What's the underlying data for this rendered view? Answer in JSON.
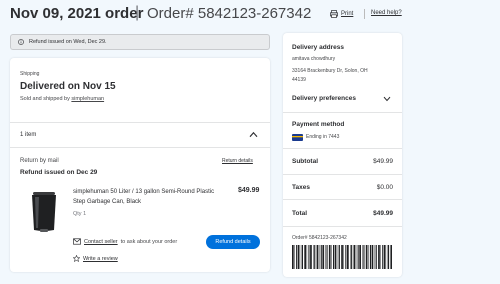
{
  "header": {
    "order_date": "Nov 09, 2021 order",
    "order_number": "Order# 5842123-267342",
    "print_label": "Print",
    "help_label": "Need help?"
  },
  "banner": {
    "text": "Refund issued on Wed, Dec 29."
  },
  "shipment": {
    "tag": "Shipping",
    "status": "Delivered on Nov 15",
    "sold_by_prefix": "Sold and shipped by",
    "seller": "simplehuman",
    "items_count": "1 item"
  },
  "return_info": {
    "method": "Return by mail",
    "details_link": "Return details",
    "refund_status": "Refund issued on Dec 29"
  },
  "product": {
    "title": "simplehuman 50 Liter / 13 gallon Semi-Round Plastic Step Garbage Can, Black",
    "price": "$49.99",
    "qty": "Qty 1",
    "contact_link": "Contact seller",
    "contact_suffix": "to ask about your order",
    "refund_button": "Refund details",
    "review_link": "Write a review"
  },
  "sidebar": {
    "delivery_address_label": "Delivery address",
    "address_line1": "amitava chowdhury",
    "address_line2": "33164 Brackenbury Dr, Solon, OH",
    "address_line3": "44139",
    "delivery_prefs_label": "Delivery preferences",
    "payment_label": "Payment method",
    "card_text": "Ending in 7443",
    "subtotal_label": "Subtotal",
    "subtotal_value": "$49.99",
    "taxes_label": "Taxes",
    "taxes_value": "$0.00",
    "total_label": "Total",
    "total_value": "$49.99",
    "order_ref": "Order# 5842123-267342"
  },
  "colors": {
    "accent": "#0071dc",
    "background": "#f2f8fd"
  }
}
